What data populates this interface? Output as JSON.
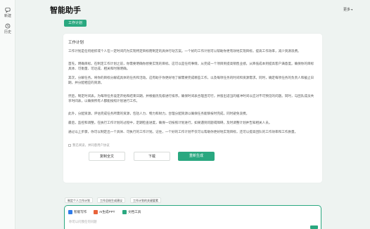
{
  "app": {
    "title": "智能助手",
    "more_label": "更多"
  },
  "sidebar": {
    "items": [
      {
        "label": "新建",
        "icon": "new-chat-icon"
      },
      {
        "label": "历史",
        "icon": "history-icon"
      }
    ]
  },
  "active_tool": {
    "label": "工作计划"
  },
  "answer": {
    "title": "工作计划",
    "paragraphs": [
      "工作计划是任何组织或个人在一定时间内为实现特定目标而制定的具体行动方案。一个好的工作计划可以帮助你更有效地实现目标，提高工作效率，减少资源浪费。",
      "首先，明确目标。在制定工作计划之前，你需要明确你想要实现的目标。这可以是任何事情，从完成一个项目到提高销售业绩，从降低成本到提高客户满意度。确保你的目标具体、可衡量、可达成、相关和时限明确。",
      "其次，分解任务。将你的目标分解成具体的任务和活动。这有助于你更好地了解需要完成哪些工作，以及每项任务的时间和资源需求。同时，确定每项任务的负责人和截止日期，并分配相应的资源。",
      "然后，制定时间表。为每项任务设定开始和结束日期，并根据优先级进行排序。确保时间表合理且可行，并留出适当的缓冲时间以应对不可预见的问题。同时，与团队成员共享时间表，以确保所有人都能按照计划进行工作。",
      "此外，分配资源。评估完成任务所需的资源，包括人力、物力和财力。合理分配资源以确保任务能够按时完成，同时避免浪费。",
      "最后，监控和调整。在执行工作计划的过程中，定期检查进度，确保一切按照计划进行。如果遇到问题或障碍，及时调整计划并告知相关人员。",
      "通过以上步骤，你可以制定出一个具体、可执行的工作计划。记住，一个好的工作计划不仅可以帮助你更好地实现目标，还可以提高团队的工作效率和工作质量。"
    ],
    "agreement": "我已阅读，并同意用户协议",
    "buttons": {
      "copy": "复制全文",
      "download": "下载",
      "regenerate": "重新生成"
    }
  },
  "suggestions": [
    "制定个人工作计划",
    "工作总结生成建议",
    "工作计划的关键要素"
  ],
  "composer": {
    "tools": [
      {
        "label": "智能写作",
        "icon": "writing-icon",
        "color": "#2f7be8"
      },
      {
        "label": "AI生成PPT",
        "icon": "ppt-icon",
        "color": "#e8633b"
      },
      {
        "label": "文档工具",
        "icon": "document-tool-icon",
        "color": "#2aa880"
      }
    ],
    "placeholder": "你可以问我任何问题"
  },
  "colors": {
    "accent": "#2aa880",
    "background": "#eef3f1"
  }
}
